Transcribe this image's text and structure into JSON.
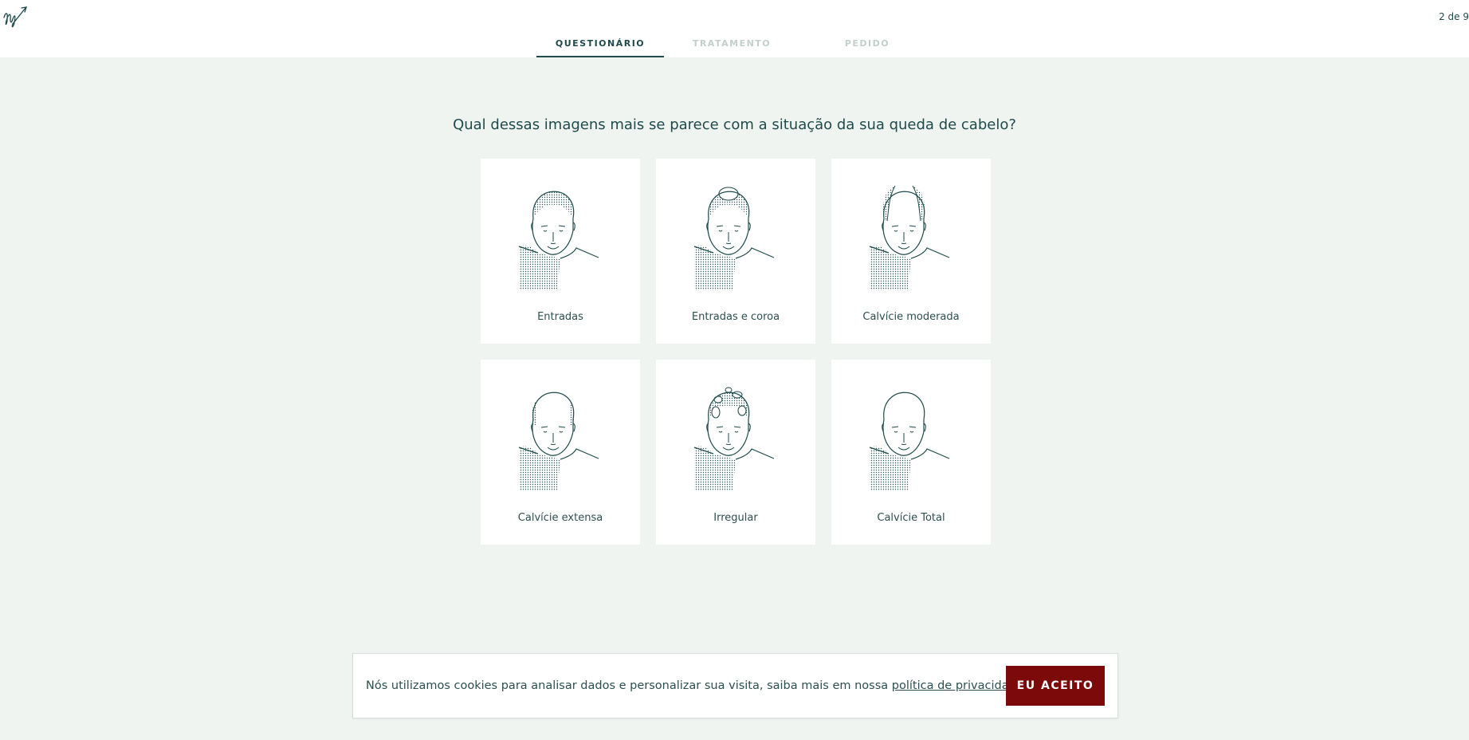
{
  "header": {
    "logo_icon": "signature-logo-icon",
    "step_counter": "2 de 9",
    "tabs": [
      {
        "label": "QUESTIONÁRIO",
        "active": true
      },
      {
        "label": "TRATAMENTO",
        "active": false
      },
      {
        "label": "PEDIDO",
        "active": false
      }
    ]
  },
  "main": {
    "question": "Qual dessas imagens mais se parece com a situação da sua queda de cabelo?",
    "options": [
      {
        "label": "Entradas",
        "icon": "receding-hairline-icon"
      },
      {
        "label": "Entradas e coroa",
        "icon": "receding-crown-icon"
      },
      {
        "label": "Calvície moderada",
        "icon": "moderate-baldness-icon"
      },
      {
        "label": "Calvície extensa",
        "icon": "extensive-baldness-icon"
      },
      {
        "label": "Irregular",
        "icon": "irregular-hairloss-icon"
      },
      {
        "label": "Calvície Total",
        "icon": "total-baldness-icon"
      }
    ]
  },
  "cookie_banner": {
    "text": "Nós utilizamos cookies para analisar dados e personalizar sua visita, saiba mais em nossa ",
    "link_text": "política de privacidade",
    "accept_label": "EU ACEITO"
  },
  "colors": {
    "primary": "#1f4a4a",
    "background": "#eff4f1",
    "accept_button": "#7c0a0a",
    "tab_inactive": "#c3cfcc"
  }
}
